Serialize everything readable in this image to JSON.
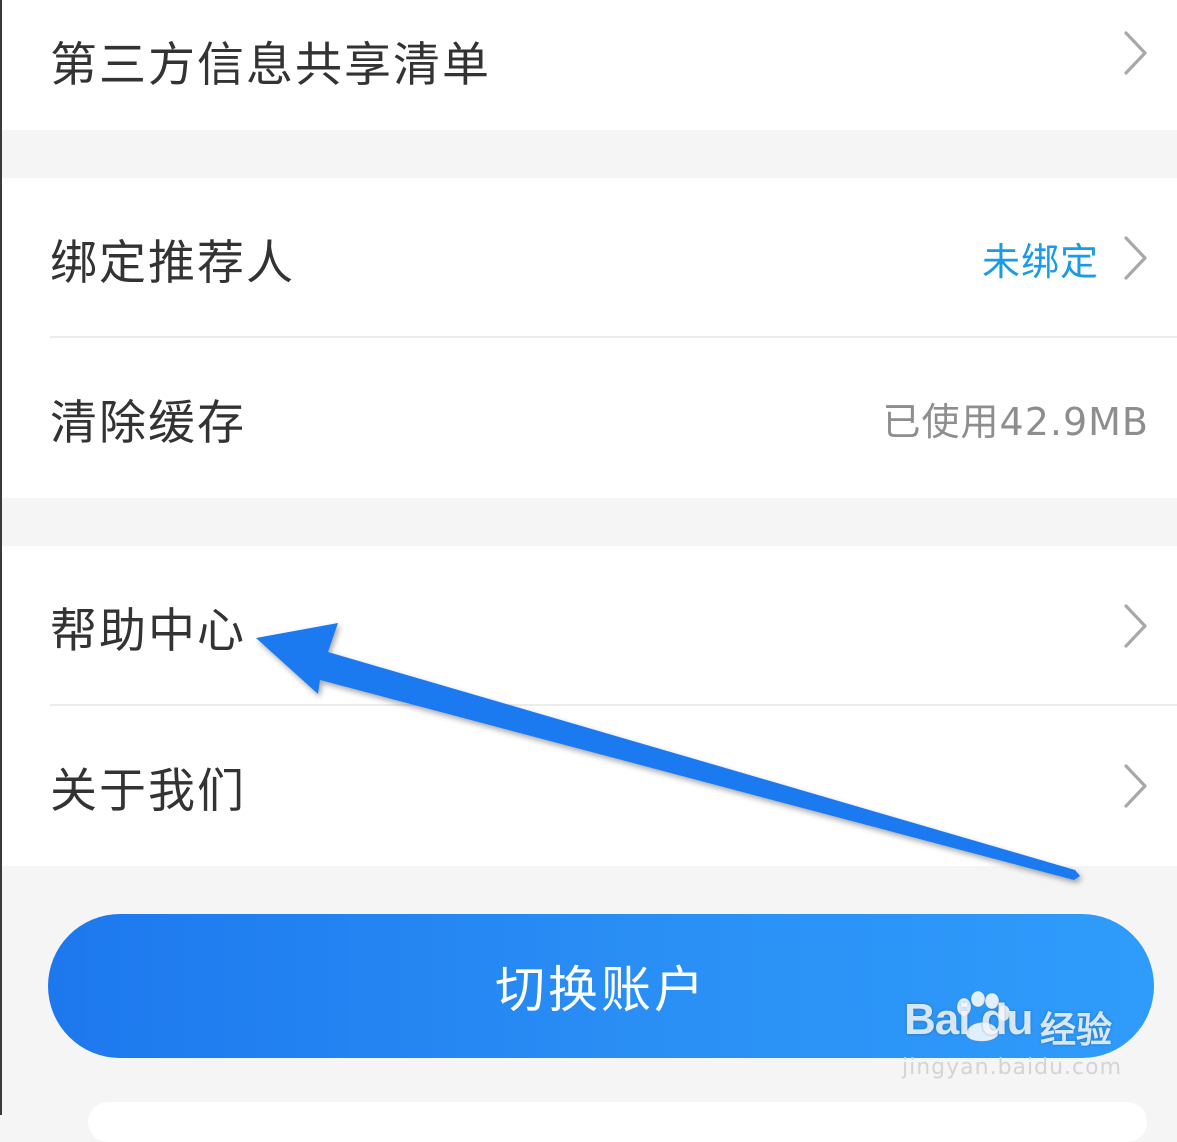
{
  "settings_groups": [
    {
      "items": [
        {
          "label": "第三方信息共享清单",
          "value": "",
          "has_chevron": true
        }
      ]
    },
    {
      "items": [
        {
          "label": "绑定推荐人",
          "value": "未绑定",
          "has_chevron": true
        },
        {
          "label": "清除缓存",
          "value": "已使用42.9MB",
          "has_chevron": false
        }
      ]
    },
    {
      "items": [
        {
          "label": "帮助中心",
          "value": "",
          "has_chevron": true
        },
        {
          "label": "关于我们",
          "value": "",
          "has_chevron": true
        }
      ]
    }
  ],
  "switch_account_button": {
    "label": "切换账户"
  },
  "annotation": {
    "type": "arrow",
    "points_to": "帮助中心",
    "color": "#1e7af0"
  },
  "watermark": {
    "logo": "Bai du",
    "text": "经验",
    "url": "jingyan.baidu.com"
  },
  "colors": {
    "accent_blue": "#1a9be8",
    "button_blue": "#2a8ff5",
    "page_background": "#f5f5f5"
  },
  "icons": {
    "chevron": "chevron-right-icon",
    "arrow": "annotation-arrow-icon",
    "paw": "baidu-paw-icon"
  }
}
